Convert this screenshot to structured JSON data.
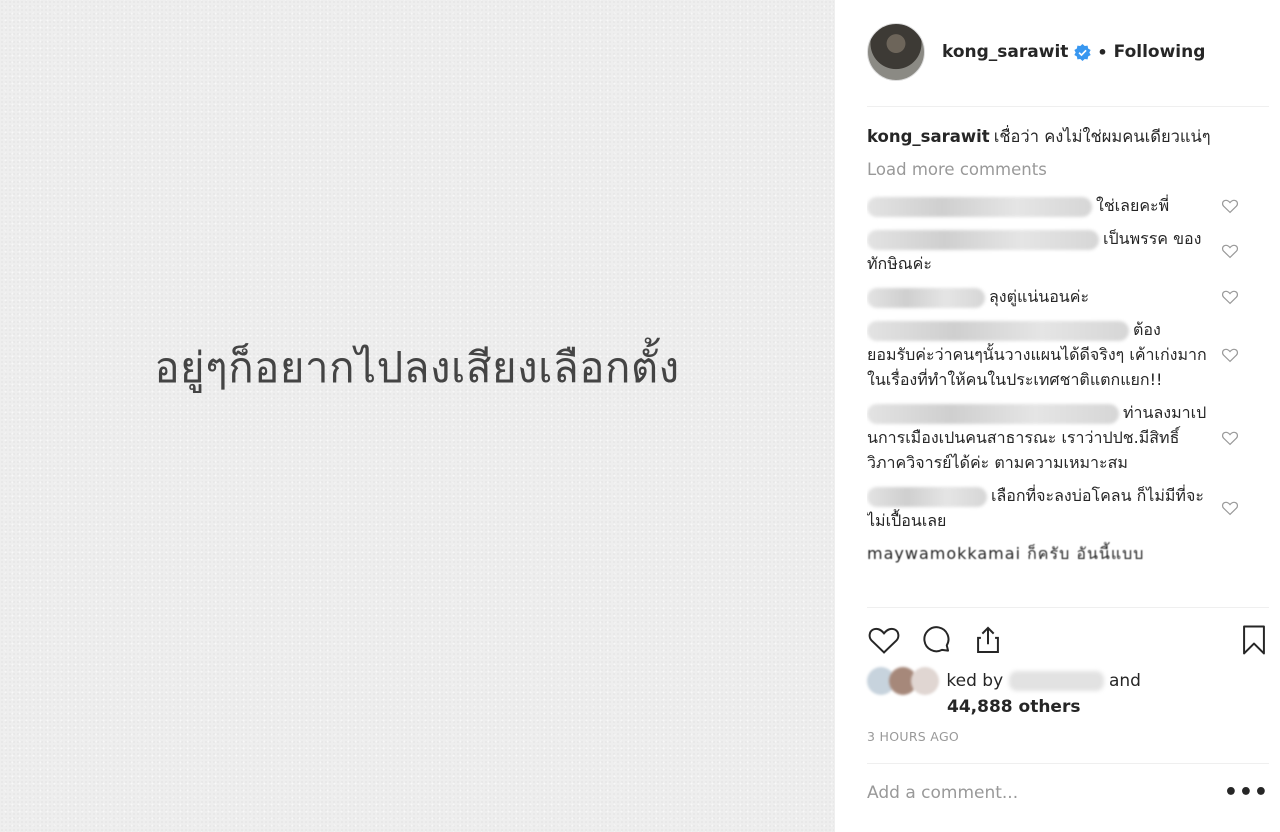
{
  "post": {
    "image_text": "อยู่ๆก็อยากไปลงเสียงเลือกตั้ง"
  },
  "header": {
    "username": "kong_sarawit",
    "separator": "•",
    "follow_state": "Following",
    "verified_icon": "verified-badge-icon",
    "verified_color": "#3897f0"
  },
  "caption": {
    "username": "kong_sarawit",
    "text": "เชื่อว่า คงไม่ใช่ผมคนเดียวแน่ๆ"
  },
  "comments": {
    "load_more_label": "Load more comments",
    "items": [
      {
        "text": "ใช่เลยคะพี่"
      },
      {
        "text": "เป็นพรรค ของทักษิณค่ะ"
      },
      {
        "text": "ลุงตู่แน่นอนค่ะ"
      },
      {
        "text": "ต้อง ยอมรับค่ะว่าคนๆนั้นวางแผนได้ดีจริงๆ เค้าเก่งมากในเรื่องที่ทำให้คนในประเทศชาติแตกแยก!!"
      },
      {
        "text": "ท่านลงมาเปนการเมืองเปนคนสาธารณะ เราว่าปปช.มีสิทธิ์วิภาควิจารย์ได้ค่ะ ตามความเหมาะสม"
      },
      {
        "text": "เลือกที่จะลงบ่อโคลน ก็ไม่มีที่จะไม่เปื้อนเลย"
      }
    ],
    "partial_text": "maywamokkamai ก็ครับ อันนี้แบบ"
  },
  "actions": {
    "like_icon": "heart-icon",
    "comment_icon": "comment-icon",
    "share_icon": "share-icon",
    "save_icon": "bookmark-icon"
  },
  "likes": {
    "prefix": "ked by",
    "suffix": "and",
    "count": "44,888 others"
  },
  "timestamp": "3 HOURS AGO",
  "add_comment": {
    "placeholder": "Add a comment...",
    "more_label": "•••"
  }
}
